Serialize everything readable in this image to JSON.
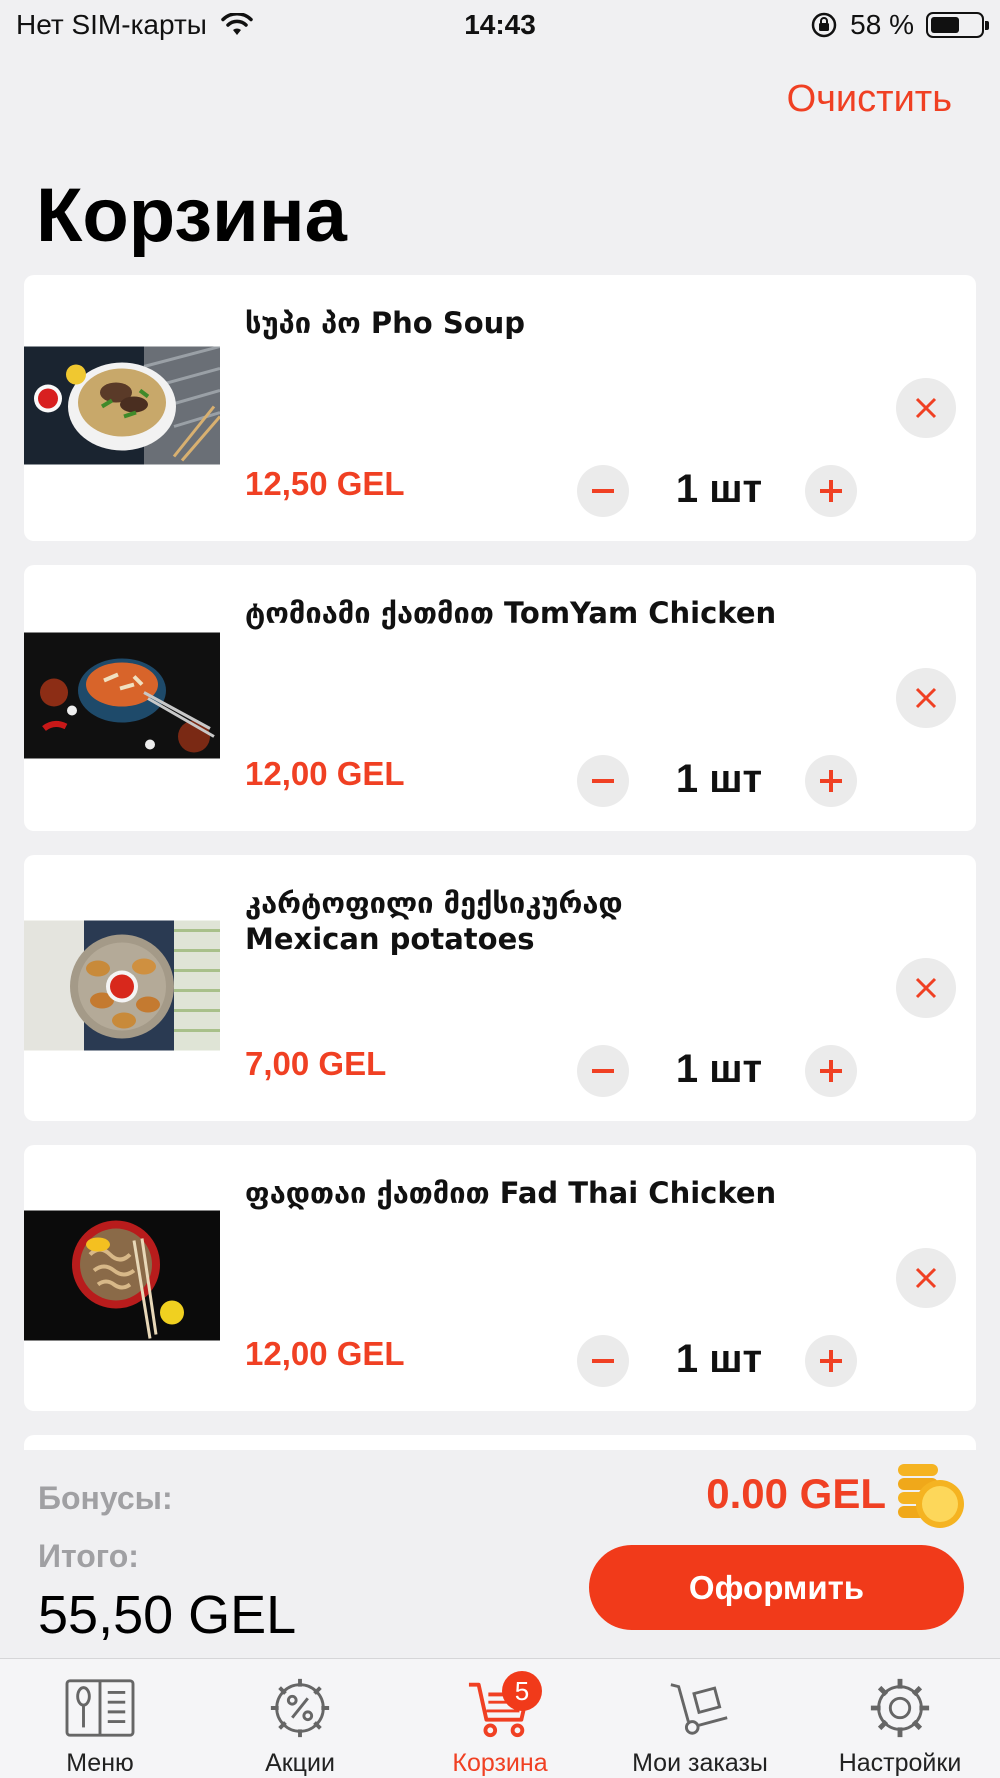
{
  "status_bar": {
    "carrier": "Нет SIM-карты",
    "time": "14:43",
    "battery": "58 %",
    "battery_level": 0.58
  },
  "header": {
    "clear_label": "Очистить",
    "title": "Корзина"
  },
  "cart": {
    "items": [
      {
        "name": "სუპი პო Pho Soup",
        "price": "12,50 GEL",
        "quantity": "1 шт"
      },
      {
        "name": "ტომიამი ქათმით TomYam Chicken",
        "price": "12,00 GEL",
        "quantity": "1 шт"
      },
      {
        "name": "კარტოფილი მექსიკურად\nMexican potatoes",
        "price": "7,00 GEL",
        "quantity": "1 шт"
      },
      {
        "name": "ფადთაი ქათმით Fad Thai Chicken",
        "price": "12,00 GEL",
        "quantity": "1 шт"
      }
    ]
  },
  "summary": {
    "bonus_label": "Бонусы:",
    "bonus_value": "0.00 GEL",
    "total_label": "Итого:",
    "total_value": "55,50 GEL",
    "checkout_label": "Оформить"
  },
  "tabs": [
    {
      "label": "Меню",
      "icon": "menu-book-icon"
    },
    {
      "label": "Акции",
      "icon": "discount-gear-icon"
    },
    {
      "label": "Корзина",
      "icon": "cart-icon",
      "badge": "5",
      "active": true
    },
    {
      "label": "Мои заказы",
      "icon": "hand-truck-icon"
    },
    {
      "label": "Настройки",
      "icon": "gear-icon"
    }
  ],
  "colors": {
    "accent": "#f04023",
    "button": "#f13a1a",
    "background": "#f0f0f2"
  }
}
